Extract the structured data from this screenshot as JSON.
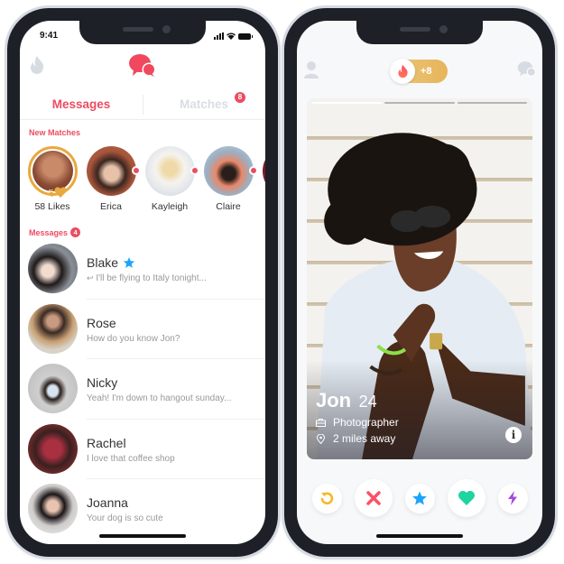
{
  "messages_screen": {
    "status_bar": {
      "time": "9:41"
    },
    "tabs": [
      {
        "label": "Messages",
        "active": true
      },
      {
        "label": "Matches",
        "active": false,
        "badge": "8"
      }
    ],
    "new_matches": {
      "label": "New Matches",
      "items": [
        {
          "name": "58 Likes",
          "type": "likes"
        },
        {
          "name": "Erica",
          "unread": true
        },
        {
          "name": "Kayleigh",
          "unread": true
        },
        {
          "name": "Claire",
          "unread": true
        }
      ]
    },
    "messages": {
      "label": "Messages",
      "count": "4",
      "items": [
        {
          "name": "Blake",
          "preview": "I'll be flying to Italy tonight...",
          "replied": true,
          "super_like": true
        },
        {
          "name": "Rose",
          "preview": "How do you know Jon?"
        },
        {
          "name": "Nicky",
          "preview": "Yeah! I'm down to hangout sunday..."
        },
        {
          "name": "Rachel",
          "preview": "I love that coffee shop"
        },
        {
          "name": "Joanna",
          "preview": "Your dog is so cute"
        }
      ]
    }
  },
  "swipe_screen": {
    "header": {
      "gold_count": "+8"
    },
    "card": {
      "name": "Jon",
      "age": "24",
      "job": "Photographer",
      "distance": "2 miles away",
      "photo_count": 3,
      "current_photo": 1,
      "info_label": "i"
    },
    "actions": [
      {
        "name": "rewind",
        "color": "#f5b623"
      },
      {
        "name": "nope",
        "color": "#fd5068"
      },
      {
        "name": "super-like",
        "color": "#1ca4fc"
      },
      {
        "name": "like",
        "color": "#1ed4a0"
      },
      {
        "name": "boost",
        "color": "#a549dd"
      }
    ]
  },
  "colors": {
    "brand": "#ec4c62",
    "gold": "#e8a940",
    "inactive": "#dadde3"
  }
}
